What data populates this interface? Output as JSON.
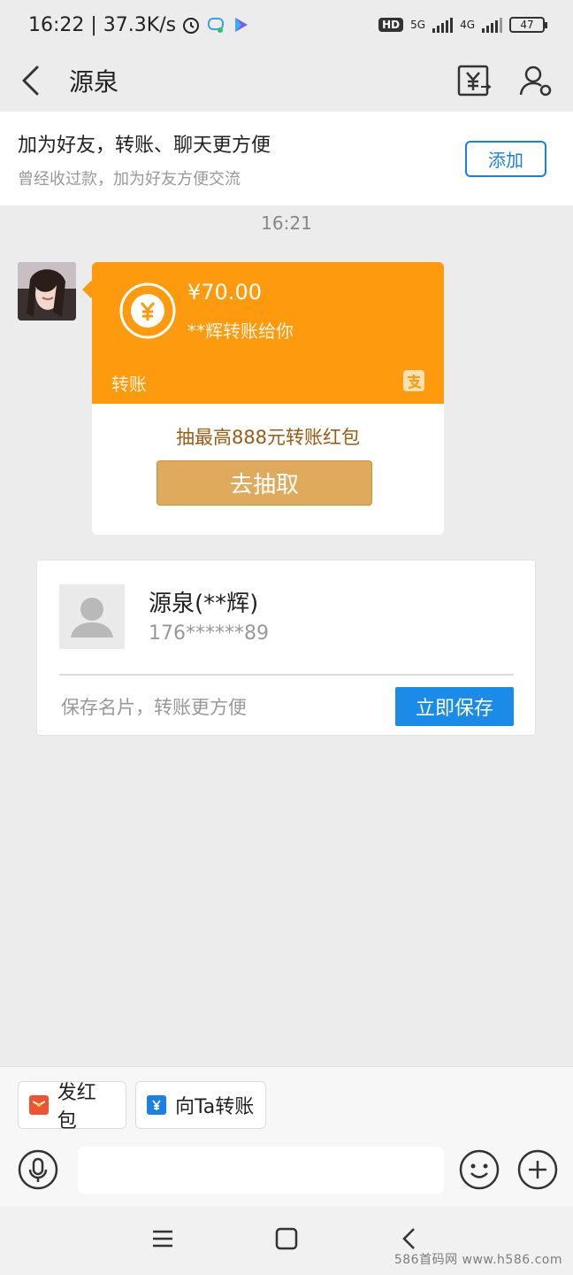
{
  "status_bar": {
    "time_speed": "16:22 | 37.3K/s",
    "hd": "HD",
    "net1": "5G",
    "net2": "4G",
    "battery": "47"
  },
  "nav": {
    "title": "源泉",
    "icons": [
      "back-icon",
      "transfer-bill-icon",
      "contact-settings-icon"
    ]
  },
  "friend_banner": {
    "title": "加为好友，转账、聊天更方便",
    "subtitle": "曾经收过款，加为好友方便交流",
    "add_label": "添加"
  },
  "chat": {
    "timestamp": "16:21",
    "transfer": {
      "amount": "¥70.00",
      "description": "**辉转账给你",
      "label": "转账",
      "promo": "抽最高888元转账红包",
      "draw_label": "去抽取",
      "colors": {
        "card": "#fd9a0e",
        "button": "#e0aa5c"
      }
    },
    "contact_card": {
      "name": "源泉(**辉)",
      "phone": "176******89",
      "hint": "保存名片，转账更方便",
      "save_label": "立即保存"
    }
  },
  "toolbar": {
    "red_packet_label": "发红包",
    "transfer_label": "向Ta转账",
    "input_placeholder": ""
  },
  "watermark": "586首码网 www.h586.com"
}
